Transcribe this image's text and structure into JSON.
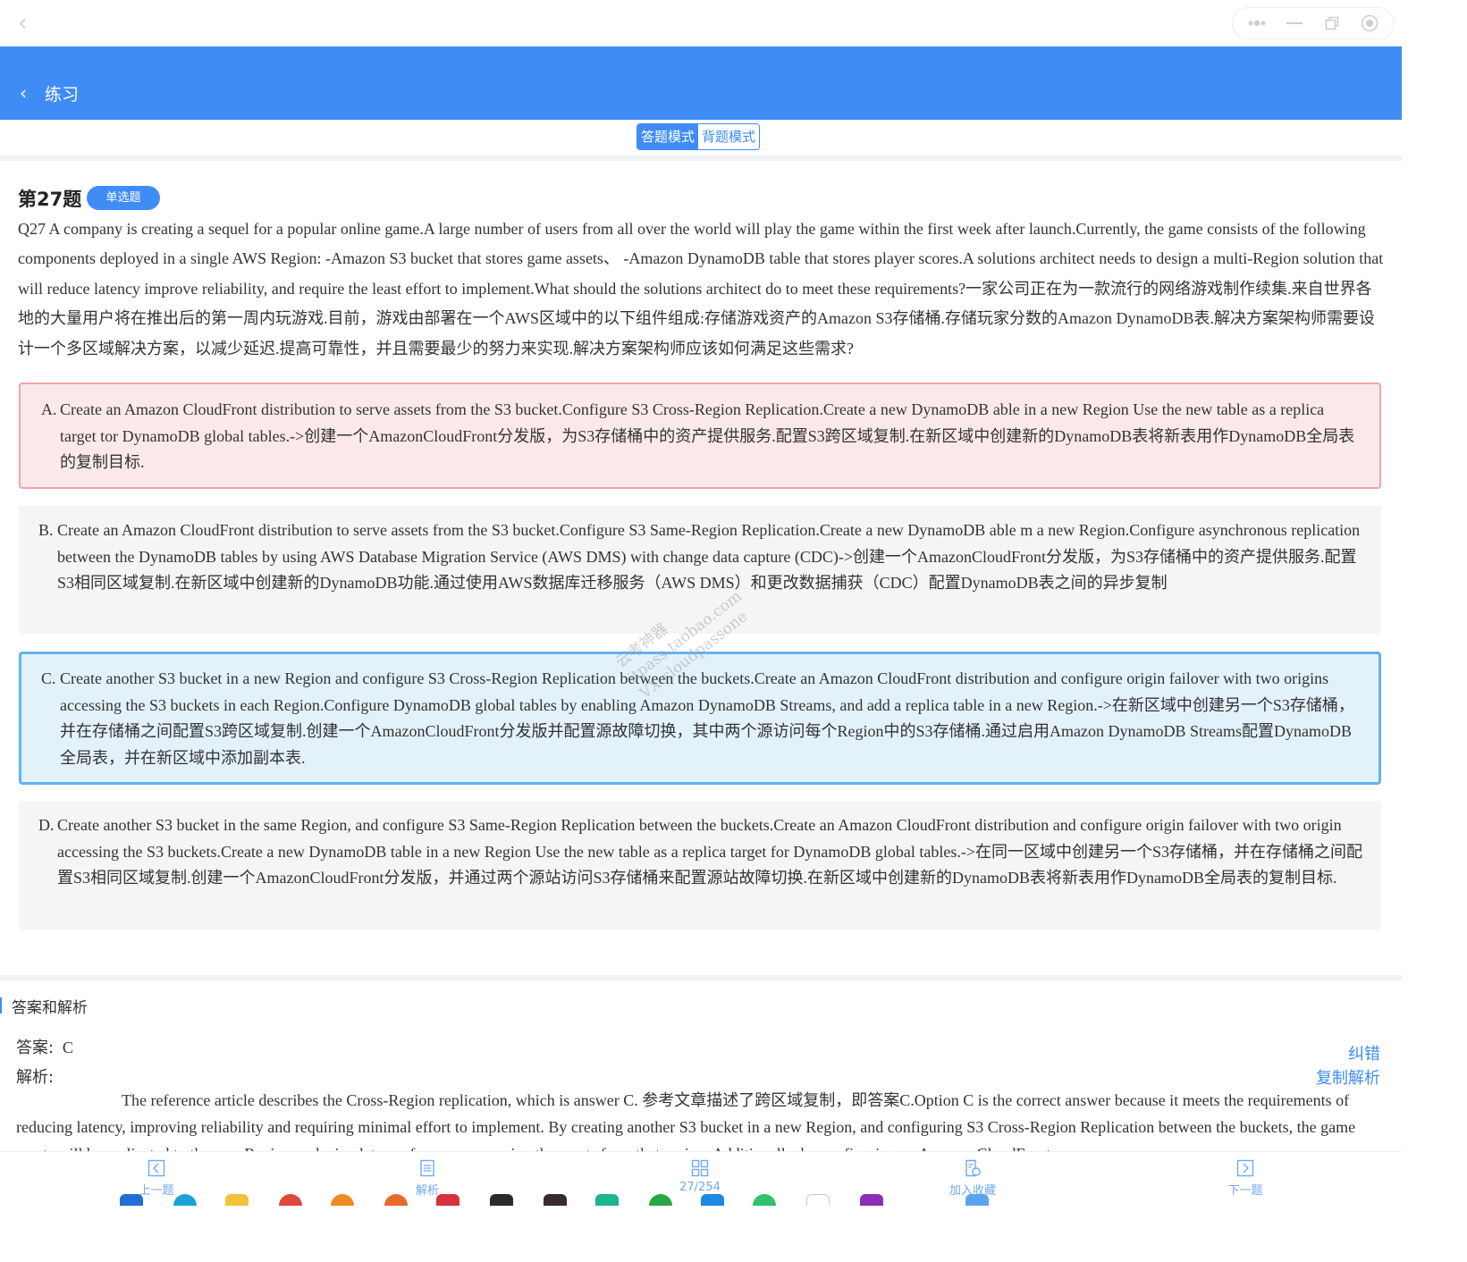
{
  "window": {
    "back_icon": "chevron-left-icon",
    "controls": [
      "more-icon",
      "minimize-icon",
      "restore-icon",
      "record-icon"
    ]
  },
  "header": {
    "back_icon": "chevron-left-icon",
    "title": "练习"
  },
  "mode_switch": {
    "answer_mode": "答题模式",
    "recite_mode": "背题模式",
    "active": "答题模式"
  },
  "question": {
    "number_label": "第27题",
    "type_badge": "单选题",
    "text": "Q27 A company is creating a sequel for a popular online game.A large number of users from all over the world will play the game within the first week after launch.Currently, the game consists of the following components deployed in a single AWS Region: -Amazon S3 bucket that stores game assets、 -Amazon DynamoDB table that stores player scores.A solutions architect needs to design a multi-Region solution that will reduce latency improve reliability, and require the least effort to implement.What should the solutions architect do to meet these requirements?一家公司正在为一款流行的网络游戏制作续集.来自世界各地的大量用户将在推出后的第一周内玩游戏.目前，游戏由部署在一个AWS区域中的以下组件组成:存储游戏资产的Amazon S3存储桶.存储玩家分数的Amazon DynamoDB表.解决方案架构师需要设计一个多区域解决方案，以减少延迟.提高可靠性，并且需要最少的努力来实现.解决方案架构师应该如何满足这些需求?",
    "options": [
      {
        "letter": "A.",
        "text": "Create an Amazon CloudFront distribution to serve assets from the S3 bucket.Configure S3 Cross-Region Replication.Create a new DynamoDB able in a new Region Use the new table as a replica target tor DynamoDB global tables.->创建一个AmazonCloudFront分发版，为S3存储桶中的资产提供服务.配置S3跨区域复制.在新区域中创建新的DynamoDB表将新表用作DynamoDB全局表的复制目标.",
        "state": "wrong-selected"
      },
      {
        "letter": "B.",
        "text": "Create an Amazon CloudFront distribution to serve assets from the S3 bucket.Configure S3 Same-Region Replication.Create a new DynamoDB able m a new Region.Configure asynchronous replication between the DynamoDB tables by using AWS Database Migration Service (AWS DMS) with change data capture (CDC)->创建一个AmazonCloudFront分发版，为S3存储桶中的资产提供服务.配置S3相同区域复制.在新区域中创建新的DynamoDB功能.通过使用AWS数据库迁移服务（AWS DMS）和更改数据捕获（CDC）配置DynamoDB表之间的异步复制",
        "state": "normal"
      },
      {
        "letter": "C.",
        "text": "Create another S3 bucket in a new Region and configure S3 Cross-Region Replication between the buckets.Create an Amazon CloudFront distribution and configure origin failover with two origins accessing the S3 buckets in each Region.Configure DynamoDB global tables by enabling Amazon DynamoDB Streams, and add a replica table in a new Region.->在新区域中创建另一个S3存储桶，并在存储桶之间配置S3跨区域复制.创建一个AmazonCloudFront分发版并配置源故障切换，其中两个源访问每个Region中的S3存储桶.通过启用Amazon DynamoDB Streams配置DynamoDB全局表，并在新区域中添加副本表.",
        "state": "correct"
      },
      {
        "letter": "D.",
        "text": "Create another S3 bucket in the same Region, and configure S3 Same-Region Replication between the buckets.Create an Amazon CloudFront distribution and configure origin failover with two origin accessing the S3 buckets.Create a new DynamoDB table in a new Region Use the new table as a replica target for DynamoDB global tables.->在同一区域中创建另一个S3存储桶，并在存储桶之间配置S3相同区域复制.创建一个AmazonCloudFront分发版，并通过两个源站访问S3存储桶来配置源站故障切换.在新区域中创建新的DynamoDB表将新表用作DynamoDB全局表的复制目标.",
        "state": "normal"
      }
    ]
  },
  "answer": {
    "section_title": "答案和解析",
    "answer_label": "答案:",
    "answer_value": "C",
    "explanation_label": "解析:",
    "correct_link": "纠错",
    "copy_link": "复制解析",
    "explanation": "The reference article describes the Cross-Region replication, which is answer C. 参考文章描述了跨区域复制，即答案C.Option C is the correct answer because it meets the requirements of reducing latency, improving reliability and requiring minimal effort to implement. By creating another S3 bucket in a new Region, and configuring S3 Cross-Region Replication between the buckets, the game assets will be replicated to the new Region, reducing latency for users accessing the assets from that region. Additionally, by configuring an Amazon CloudFront"
  },
  "bottom_nav": {
    "prev": {
      "label": "上一题",
      "icon": "prev-box-icon"
    },
    "analysis": {
      "label": "解析",
      "icon": "document-icon"
    },
    "progress": {
      "label": "27/254",
      "icon": "grid-icon"
    },
    "favorite": {
      "label": "加入收藏",
      "icon": "favorite-doc-icon"
    },
    "next": {
      "label": "下一题",
      "icon": "next-box-icon"
    }
  },
  "watermark": [
    "云考神器",
    "itpass.taobao.com",
    "VX:cloudpassone"
  ],
  "colors": {
    "primary": "#3f8cf6",
    "wrong_bg": "#fbe9ea",
    "wrong_border": "#f2a5ab",
    "correct_bg": "#e3f1fb",
    "correct_border": "#62b3f4",
    "neutral_bg": "#f5f5f5"
  }
}
